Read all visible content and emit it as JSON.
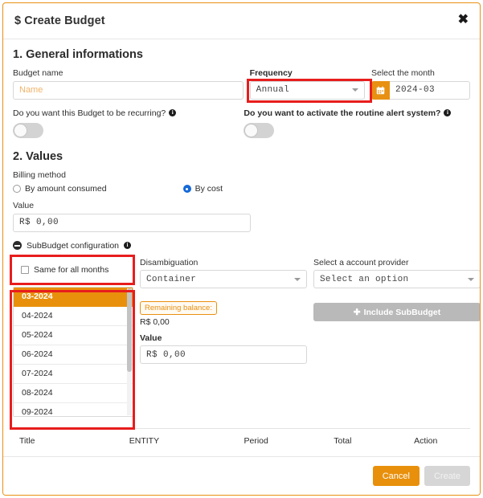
{
  "modal": {
    "title": "$ Create Budget",
    "close_icon": "close-icon"
  },
  "general": {
    "heading": "1. General informations",
    "budget_name_label": "Budget name",
    "budget_name_value": "",
    "budget_name_placeholder": "Name",
    "frequency_label": "Frequency",
    "frequency_value": "Annual",
    "month_label": "Select the month",
    "month_value": "2024-03",
    "calendar_icon": "calendar-icon",
    "recurring_question": "Do you want this Budget to be recurring?",
    "recurring_state": "off",
    "alert_question": "Do you want to activate the routine alert system?",
    "alert_state": "off"
  },
  "values": {
    "heading": "2. Values",
    "billing_method_label": "Billing method",
    "radio_amount_label": "By amount consumed",
    "radio_cost_label": "By cost",
    "selected_billing_method": "By cost",
    "value_label": "Value",
    "value_amount": "R$ 0,00"
  },
  "subbudget": {
    "header": "SubBudget configuration",
    "collapse_icon": "minus-circle-icon",
    "same_all_months_label": "Same for all months",
    "same_all_months_checked": false,
    "disambiguation_label": "Disambiguation",
    "disambiguation_value": "Container",
    "provider_label": "Select a account provider",
    "provider_value": "Select an option",
    "months": [
      "03-2024",
      "04-2024",
      "05-2024",
      "06-2024",
      "07-2024",
      "08-2024",
      "09-2024"
    ],
    "selected_month": "03-2024",
    "remaining_balance_label": "Remaining balance:",
    "remaining_balance_value": "R$ 0,00",
    "sub_value_label": "Value",
    "sub_value_amount": "R$ 0,00",
    "include_button_label": "Include SubBudget"
  },
  "table": {
    "columns": [
      "Title",
      "ENTITY",
      "Period",
      "Total",
      "Action"
    ],
    "rows": []
  },
  "footer": {
    "cancel_label": "Cancel",
    "create_label": "Create"
  },
  "colors": {
    "accent_orange": "#e8900c",
    "annotation_red": "#e81d1d",
    "radio_blue": "#1669d8",
    "disabled_gray": "#b9b9b9"
  }
}
